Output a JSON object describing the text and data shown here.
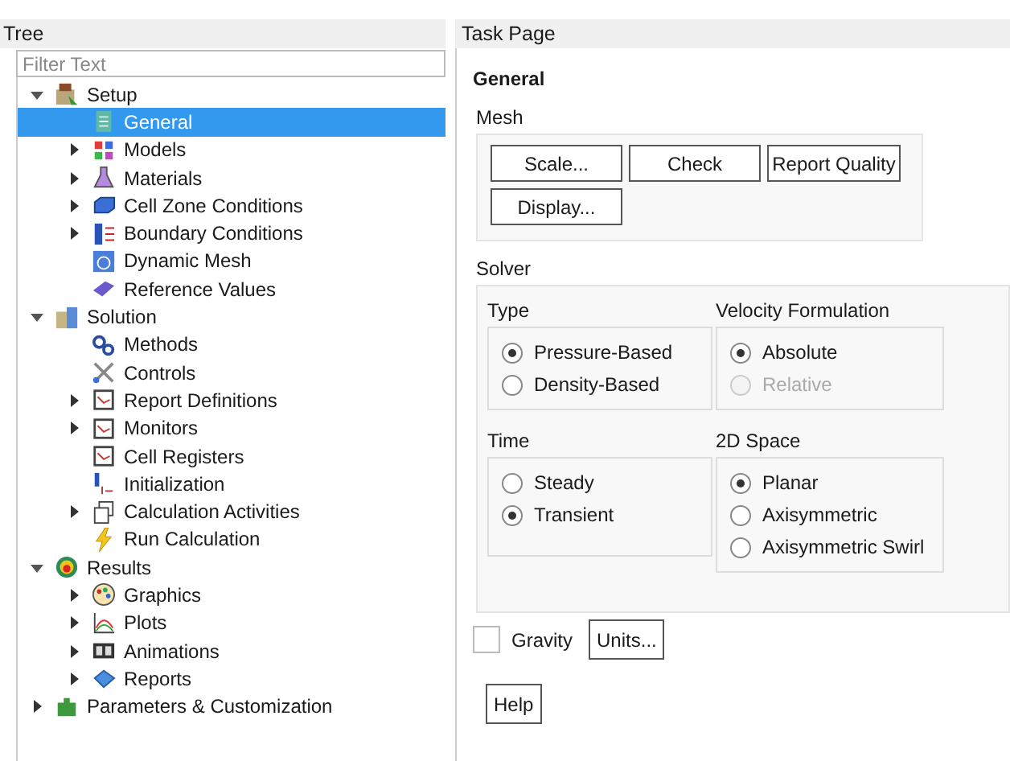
{
  "tree_panel": {
    "title": "Tree",
    "filter": {
      "placeholder": "Filter Text"
    },
    "items": [
      {
        "label": "Setup",
        "expandable": true,
        "expanded": true,
        "selected": false,
        "children": [
          {
            "label": "General",
            "expandable": false,
            "selected": true
          },
          {
            "label": "Models",
            "expandable": true,
            "expanded": false,
            "selected": false
          },
          {
            "label": "Materials",
            "expandable": true,
            "expanded": false,
            "selected": false
          },
          {
            "label": "Cell Zone Conditions",
            "expandable": true,
            "expanded": false,
            "selected": false
          },
          {
            "label": "Boundary Conditions",
            "expandable": true,
            "expanded": false,
            "selected": false
          },
          {
            "label": "Dynamic Mesh",
            "expandable": false,
            "selected": false
          },
          {
            "label": "Reference Values",
            "expandable": false,
            "selected": false
          }
        ]
      },
      {
        "label": "Solution",
        "expandable": true,
        "expanded": true,
        "selected": false,
        "children": [
          {
            "label": "Methods",
            "expandable": false,
            "selected": false
          },
          {
            "label": "Controls",
            "expandable": false,
            "selected": false
          },
          {
            "label": "Report Definitions",
            "expandable": true,
            "expanded": false,
            "selected": false
          },
          {
            "label": "Monitors",
            "expandable": true,
            "expanded": false,
            "selected": false
          },
          {
            "label": "Cell Registers",
            "expandable": false,
            "selected": false
          },
          {
            "label": "Initialization",
            "expandable": false,
            "selected": false
          },
          {
            "label": "Calculation Activities",
            "expandable": true,
            "expanded": false,
            "selected": false
          },
          {
            "label": "Run Calculation",
            "expandable": false,
            "selected": false
          }
        ]
      },
      {
        "label": "Results",
        "expandable": true,
        "expanded": true,
        "selected": false,
        "children": [
          {
            "label": "Graphics",
            "expandable": true,
            "expanded": false,
            "selected": false
          },
          {
            "label": "Plots",
            "expandable": true,
            "expanded": false,
            "selected": false
          },
          {
            "label": "Animations",
            "expandable": true,
            "expanded": false,
            "selected": false
          },
          {
            "label": "Reports",
            "expandable": true,
            "expanded": false,
            "selected": false
          }
        ]
      },
      {
        "label": "Parameters & Customization",
        "expandable": true,
        "expanded": false,
        "selected": false
      }
    ]
  },
  "task_page": {
    "title": "Task Page",
    "heading": "General",
    "mesh": {
      "label": "Mesh",
      "buttons": [
        "Scale...",
        "Check",
        "Report Quality",
        "Display..."
      ]
    },
    "solver": {
      "label": "Solver",
      "groups": [
        {
          "label": "Type",
          "options": [
            {
              "label": "Pressure-Based",
              "selected": true,
              "disabled": false
            },
            {
              "label": "Density-Based",
              "selected": false,
              "disabled": false
            }
          ]
        },
        {
          "label": "Velocity Formulation",
          "options": [
            {
              "label": "Absolute",
              "selected": true,
              "disabled": false
            },
            {
              "label": "Relative",
              "selected": false,
              "disabled": true
            }
          ]
        },
        {
          "label": "Time",
          "options": [
            {
              "label": "Steady",
              "selected": false,
              "disabled": false
            },
            {
              "label": "Transient",
              "selected": true,
              "disabled": false
            }
          ]
        },
        {
          "label": "2D Space",
          "options": [
            {
              "label": "Planar",
              "selected": true,
              "disabled": false
            },
            {
              "label": "Axisymmetric",
              "selected": false,
              "disabled": false
            },
            {
              "label": "Axisymmetric Swirl",
              "selected": false,
              "disabled": false
            }
          ]
        }
      ]
    },
    "gravity": {
      "label": "Gravity",
      "checked": false
    },
    "units_button": "Units...",
    "help_button": "Help"
  }
}
